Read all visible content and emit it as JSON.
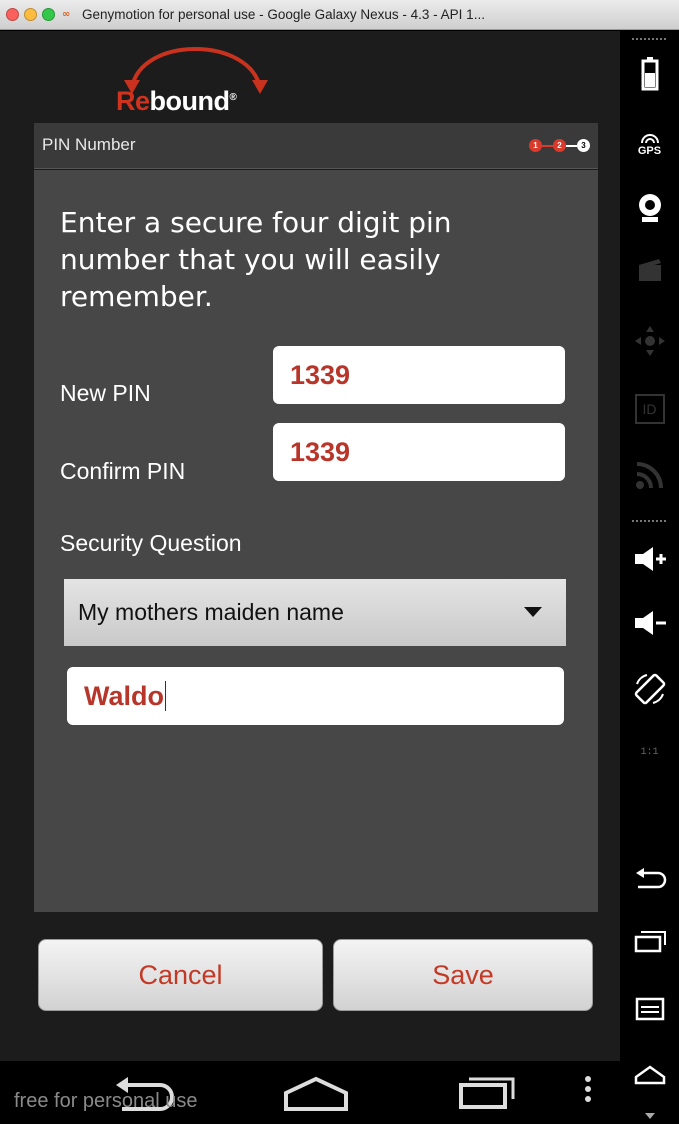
{
  "window": {
    "title": "Genymotion for personal use - Google Galaxy Nexus - 4.3 - API 1..."
  },
  "app": {
    "logo_prefix": "Re",
    "logo_suffix": "bound",
    "logo_mark": "®"
  },
  "panel": {
    "title": "PIN Number",
    "steps": [
      "1",
      "2",
      "3"
    ],
    "instructions": "Enter a secure four digit pin number that you will easily remember."
  },
  "form": {
    "new_pin_label": "New PIN",
    "new_pin_value": "1339",
    "confirm_pin_label": "Confirm PIN",
    "confirm_pin_value": "1339",
    "security_question_label": "Security Question",
    "security_question_selected": "My mothers maiden name",
    "security_answer_value": "Waldo"
  },
  "buttons": {
    "cancel": "Cancel",
    "save": "Save"
  },
  "watermark": "free for personal use",
  "sidebar": {
    "gps_label": "GPS",
    "id_label": "ID",
    "scale_label": "1:1"
  },
  "colors": {
    "accent": "#c23a26",
    "panel_bg": "#474747",
    "header_bg": "#3a3a3a"
  }
}
